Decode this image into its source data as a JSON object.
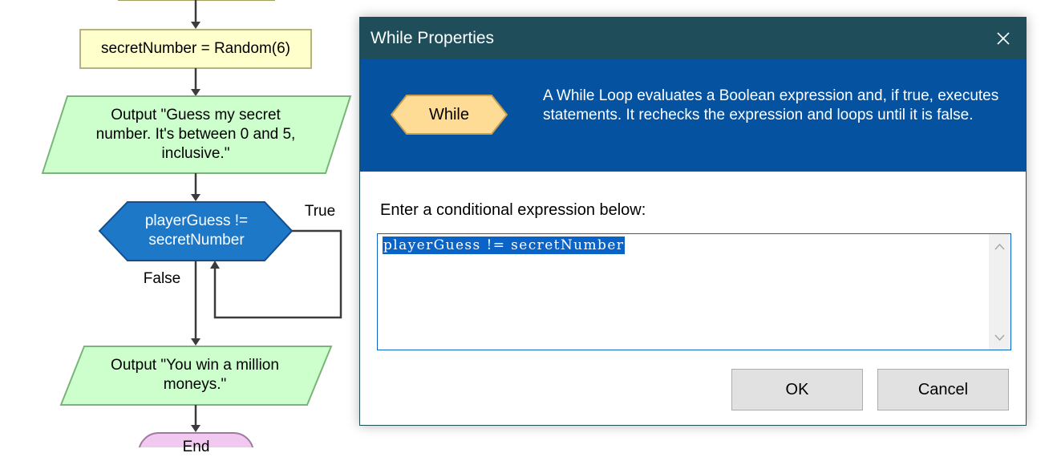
{
  "flowchart": {
    "assign_block": "secretNumber = Random(6)",
    "output_block_1": "Output \"Guess my secret number. It's between 0 and 5, inclusive.\"",
    "while_block": "playerGuess != secretNumber",
    "true_label": "True",
    "false_label": "False",
    "output_block_2": "Output \"You win a million moneys.\"",
    "end_block": "End",
    "colors": {
      "assign_fill": "#ffffcc",
      "io_fill": "#ccffcc",
      "while_fill": "#1e78c8",
      "end_fill": "#f0c8f0"
    }
  },
  "dialog": {
    "title": "While Properties",
    "close_icon": "close-icon",
    "shape_label": "While",
    "description": "A While Loop evaluates a Boolean expression and, if true, executes statements. It rechecks the expression and loops until it is false.",
    "prompt": "Enter a conditional expression below:",
    "expression_value": "playerGuess != secretNumber",
    "ok_label": "OK",
    "cancel_label": "Cancel",
    "colors": {
      "title_bar": "#1f4e5a",
      "header_band": "#0452a0",
      "selection": "#0a64c8",
      "shape_fill": "#ffdc96"
    }
  }
}
